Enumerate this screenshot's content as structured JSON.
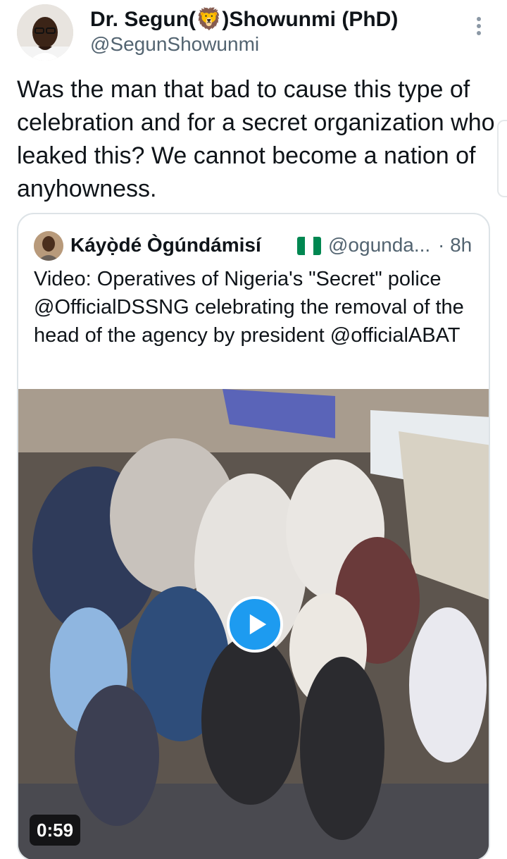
{
  "author": {
    "display_name_part1": "Dr. Segun(",
    "display_name_emoji": "lion-face-emoji",
    "display_name_part2": ")Showunmi (PhD)",
    "handle": "@SegunShowunmi",
    "avatar_icon": "profile-photo"
  },
  "tweet": {
    "text": "Was the man that bad to cause this type of celebration and for a secret organization who leaked this? We cannot become a nation of anyhowness."
  },
  "quoted_tweet": {
    "display_name": "Káyọ̀dé Ògúndámisí",
    "flag_icon": "nigeria-flag",
    "flag_colors": [
      "#008751",
      "#ffffff",
      "#008751"
    ],
    "handle": "@ogunda...",
    "time": "· 8h",
    "text": "Video: Operatives of Nigeria's \"Secret\" police @OfficialDSSNG celebrating the removal of the head of the agency by president @officialABAT",
    "video": {
      "duration": "0:59",
      "play_icon": "play-icon"
    }
  },
  "colors": {
    "accent": "#1d9bf0",
    "text_primary": "#0f1419",
    "text_secondary": "#536471",
    "border": "#dde3e7"
  }
}
